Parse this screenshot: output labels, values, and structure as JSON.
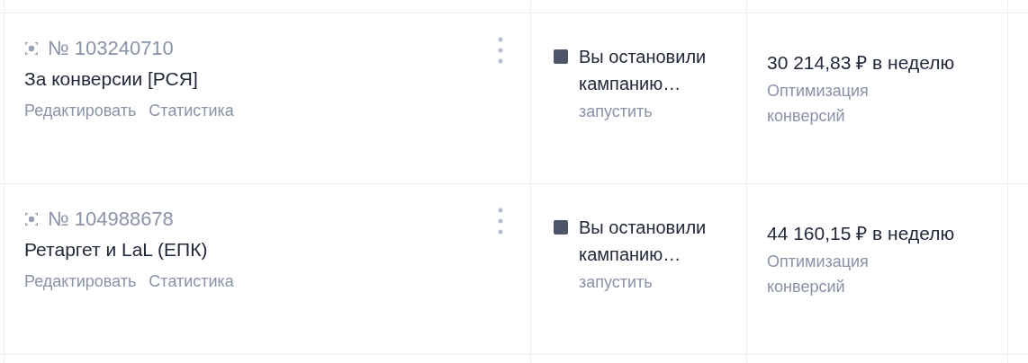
{
  "campaigns": [
    {
      "number": "№ 103240710",
      "name": "За конверсии [РСЯ]",
      "links": [
        "Редактировать",
        "Статистика"
      ],
      "status": {
        "text": "Вы остановили кампанию…",
        "color": "#4d5568",
        "action": "запустить"
      },
      "budget": "30 214,83 ₽ в неделю",
      "strategy": "Оптимизация конверсий"
    },
    {
      "number": "№ 104988678",
      "name": "Ретаргет и LaL (ЕПК)",
      "links": [
        "Редактировать",
        "Статистика"
      ],
      "status": {
        "text": "Вы остановили кампанию…",
        "color": "#4d5568",
        "action": "запустить"
      },
      "budget": "44 160,15 ₽ в неделю",
      "strategy": "Оптимизация конверсий"
    }
  ]
}
